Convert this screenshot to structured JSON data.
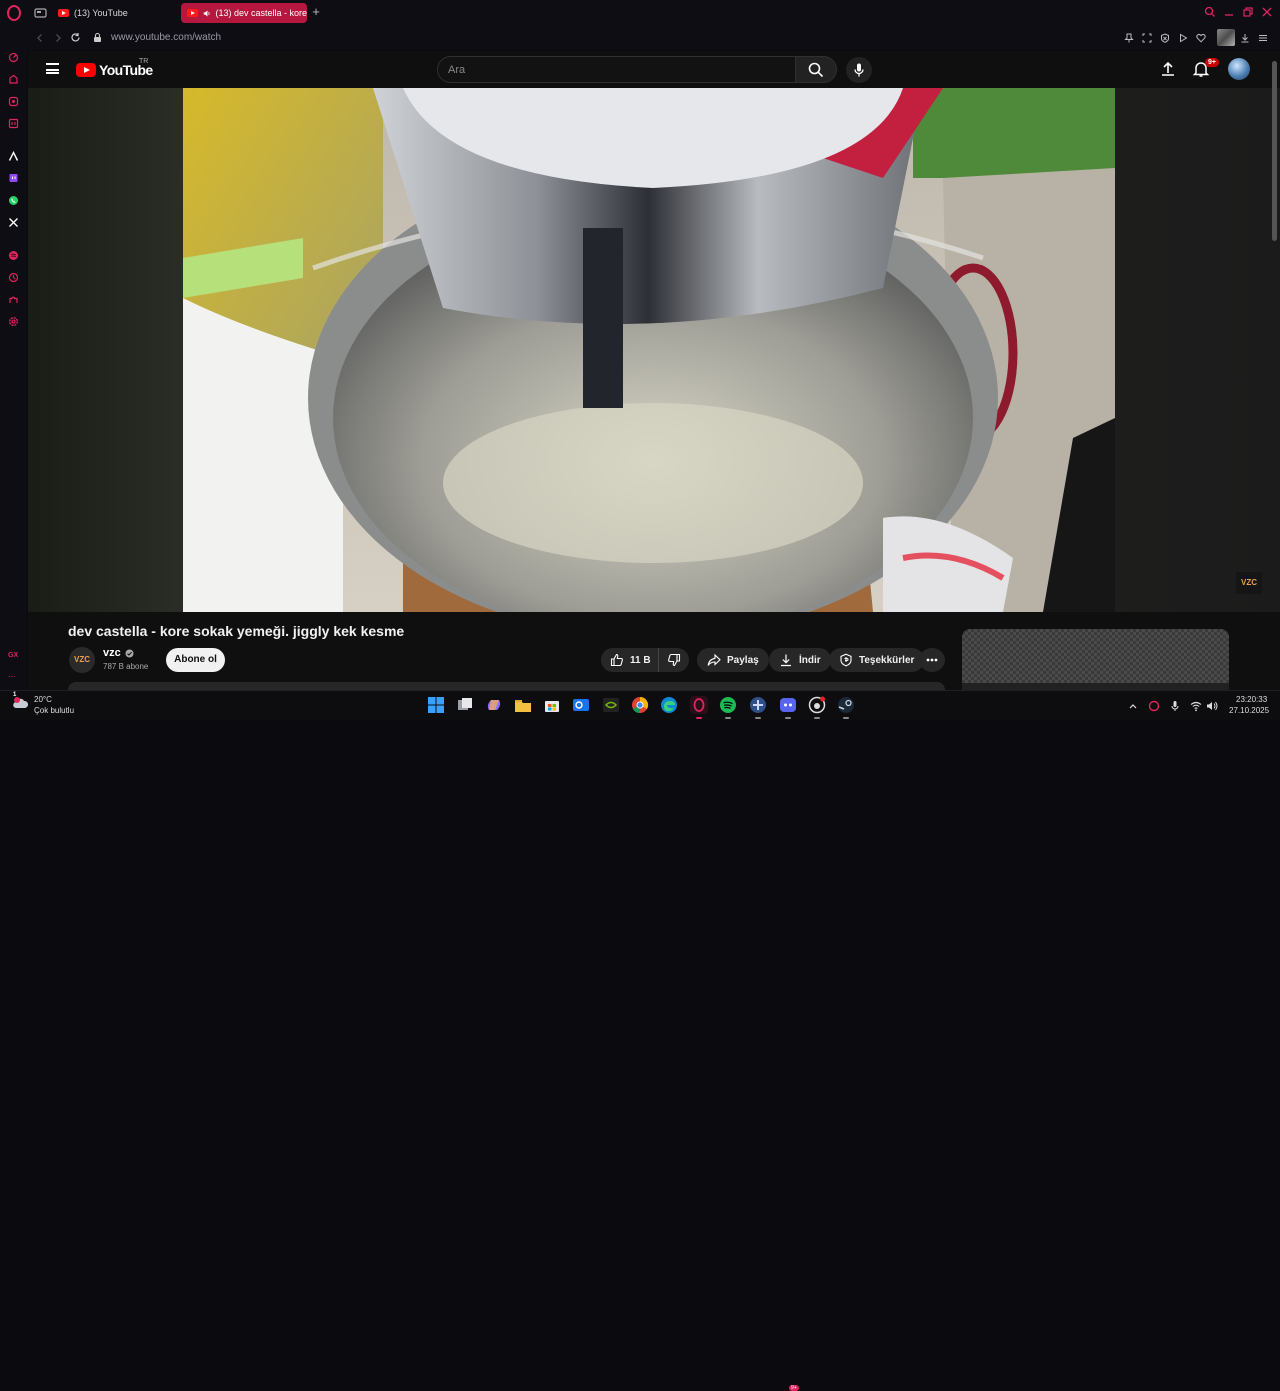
{
  "browser": {
    "tabs": [
      {
        "label": "(13) YouTube",
        "icon": "youtube-icon",
        "active": false
      },
      {
        "label": "(13) dev castella - kore",
        "icon": "speaker-icon",
        "active": true
      }
    ],
    "address": "www.youtube.com/watch",
    "accent_color": "#e0245e"
  },
  "youtube": {
    "logo_text": "YouTube",
    "region": "TR",
    "search_placeholder": "Ara",
    "notification_count": "9+"
  },
  "video": {
    "title": "dev castella - kore sokak yemeği. jiggly kek kesme",
    "channel_name": "vzc",
    "channel_badge": "VZC",
    "verified": true,
    "subscribers": "787 B abone",
    "subscribe_label": "Abone ol",
    "like_count": "11 B",
    "share_label": "Paylaş",
    "download_label": "İndir",
    "thanks_label": "Teşekkürler"
  },
  "sidebar": {
    "gx_label": "GX",
    "more_label": "..."
  },
  "taskbar": {
    "weather_temp": "20°C",
    "weather_desc": "Çok bulutlu",
    "weather_badge": "1",
    "time": "23:20:33",
    "date": "27.10.2025",
    "discord_badge": "9+"
  }
}
